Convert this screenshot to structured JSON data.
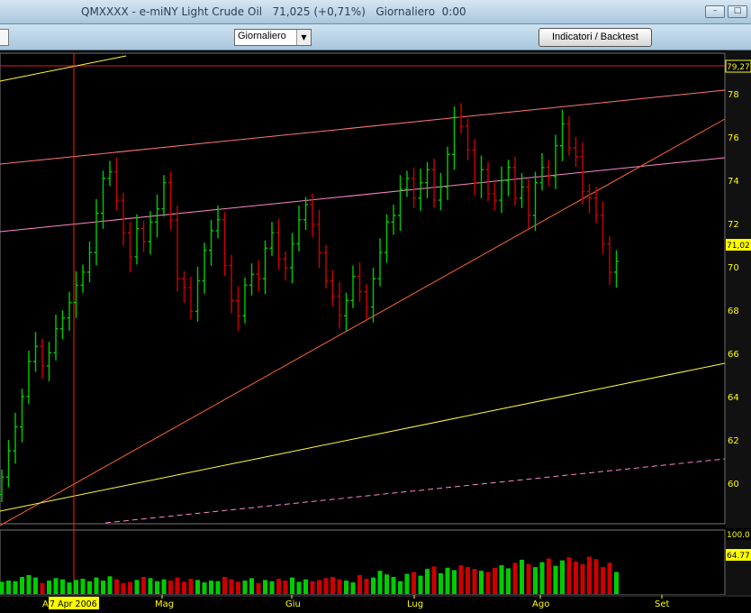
{
  "window": {
    "title": "QMXXXX - e-miNY Light Crude Oil   71,025 (+0,71%)   Giornaliero  0:00",
    "minimize_label": "–",
    "maximize_label": "□"
  },
  "toolbar": {
    "period_select_value": "Giornaliero",
    "indicators_button": "Indicatori / Backtest"
  },
  "colors": {
    "up_bar": "#00cc00",
    "down_bar": "#cc0000",
    "axis_text": "#ffff00",
    "cursor_line": "#ff2200"
  },
  "chart_data": {
    "type": "ohlc",
    "title": "",
    "price_axis": {
      "ylim": [
        59,
        80.5
      ],
      "ticks": [
        60,
        62,
        64,
        66,
        68,
        70,
        72,
        74,
        76,
        78
      ]
    },
    "price_labels": {
      "top_line": "79,27",
      "last_price": "71,02"
    },
    "volume_axis": {
      "labels": [
        "100.0",
        "64.77"
      ]
    },
    "x_tick_labels": [
      "Mag",
      "Giu",
      "Lug",
      "Ago",
      "Set"
    ],
    "cursor_date_label": "7 Apr 2006",
    "left_edge_letter": "A",
    "series": [
      {
        "name": "",
        "type": "ohlc",
        "closes": [
          61.1,
          62.3,
          63.4,
          64.8,
          66.4,
          67.1,
          66.2,
          66.8,
          67.9,
          68.4,
          69.1,
          69.9,
          70.5,
          71.4,
          73.2,
          74.8,
          75.1,
          73.8,
          72.3,
          71.2,
          72.5,
          71.9,
          72.8,
          73.4,
          74.6,
          72.9,
          70.2,
          69.8,
          68.7,
          70.1,
          71.5,
          72.4,
          72.9,
          70.8,
          69.2,
          68.5,
          69.9,
          70.4,
          70.2,
          71.6,
          72.3,
          71.1,
          70.7,
          71.8,
          72.9,
          73.6,
          72.7,
          71.4,
          70.1,
          69.4,
          68.5,
          69.2,
          70.3,
          69.6,
          68.9,
          70.2,
          71.4,
          72.8,
          73.1,
          74.3,
          74.8,
          73.9,
          74.6,
          75.2,
          73.8,
          74.4,
          75.9,
          77.6,
          77.2,
          76.1,
          74.6,
          75.2,
          74.1,
          73.8,
          74.7,
          75.3,
          73.9,
          74.4,
          73.1,
          74.6,
          75.3,
          74.9,
          76.3,
          77.3,
          76.2,
          75.8,
          74.2,
          73.9,
          73.1,
          71.8,
          70.5,
          71.0
        ],
        "volume_pct": [
          20,
          22,
          21,
          28,
          31,
          27,
          18,
          22,
          26,
          24,
          19,
          23,
          25,
          21,
          27,
          22,
          29,
          24,
          18,
          20,
          23,
          28,
          26,
          21,
          24,
          22,
          27,
          20,
          25,
          23,
          19,
          22,
          21,
          28,
          24,
          20,
          22,
          26,
          18,
          23,
          21,
          25,
          22,
          27,
          20,
          24,
          21,
          23,
          26,
          28,
          24,
          22,
          19,
          31,
          25,
          27,
          38,
          32,
          28,
          21,
          33,
          36,
          30,
          41,
          45,
          34,
          43,
          39,
          47,
          44,
          41,
          38,
          36,
          43,
          47,
          42,
          51,
          56,
          49,
          44,
          52,
          58,
          46,
          55,
          60,
          53,
          49,
          61,
          57,
          44,
          51,
          36
        ]
      }
    ]
  }
}
